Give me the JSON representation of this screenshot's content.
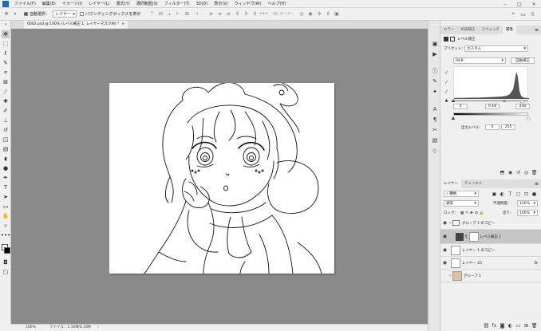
{
  "menubar": {
    "items": [
      "ファイル(F)",
      "編集(E)",
      "イメージ(I)",
      "レイヤー(L)",
      "書式(Y)",
      "選択範囲(S)",
      "フィルター(T)",
      "3D(D)",
      "表示(V)",
      "ウィンドウ(W)",
      "ヘルプ(H)"
    ]
  },
  "options_bar": {
    "auto_select_label": "自動選択：",
    "auto_select_target": "レイヤー",
    "bounding_box_label": "バウンディングボックスを表示",
    "mode_3d": "3D モード："
  },
  "document_tab": {
    "title": "0002.psd @ 100% (レベル補正 1, レイヤーマスク/8) *",
    "close": "×"
  },
  "status_bar": {
    "zoom": "100%",
    "file_info": "ファイル：1.16M/4.33M",
    "arrow": "›"
  },
  "properties_panel": {
    "tabs": [
      "カラー",
      "色調補正",
      "スウォッチ",
      "属性"
    ],
    "active_tab_index": 3,
    "title": "レベル補正",
    "preset_label": "プリセット：",
    "preset_value": "カスタム",
    "channel": "RGB",
    "auto_button": "自動補正",
    "input_black": "0",
    "input_gamma": "0.18",
    "input_white": "230",
    "output_label": "出力レベル：",
    "output_black": "0",
    "output_white": "255"
  },
  "layers_panel": {
    "tabs": [
      "レイヤー",
      "チャンネル"
    ],
    "active_tab_index": 0,
    "filter_label": "種類",
    "blend_mode": "通常",
    "opacity_label": "不透明度：",
    "opacity_value": "100%",
    "lock_label": "ロック：",
    "fill_label": "塗り：",
    "fill_value": "100%",
    "layers": [
      {
        "name": "グループ 1 のコピー",
        "kind": "group",
        "selected": false,
        "visible": true,
        "fx": false
      },
      {
        "name": "レベル補正 1",
        "kind": "adjustment",
        "selected": true,
        "visible": true,
        "fx": false
      },
      {
        "name": "レイヤー 1 のコピー",
        "kind": "pixel",
        "selected": false,
        "visible": true,
        "fx": false
      },
      {
        "name": "レイヤー 25",
        "kind": "pixel",
        "selected": false,
        "visible": true,
        "fx": true
      },
      {
        "name": "グループ 1",
        "kind": "group-image",
        "selected": false,
        "visible": false,
        "fx": false
      }
    ],
    "fx_label": "fx"
  },
  "colors": {
    "canvas_bg": "#8a8a8a",
    "panel_bg": "#f0f0f0",
    "selected_layer": "#c6c6c6",
    "ps_blue": "#1e6bb8"
  }
}
